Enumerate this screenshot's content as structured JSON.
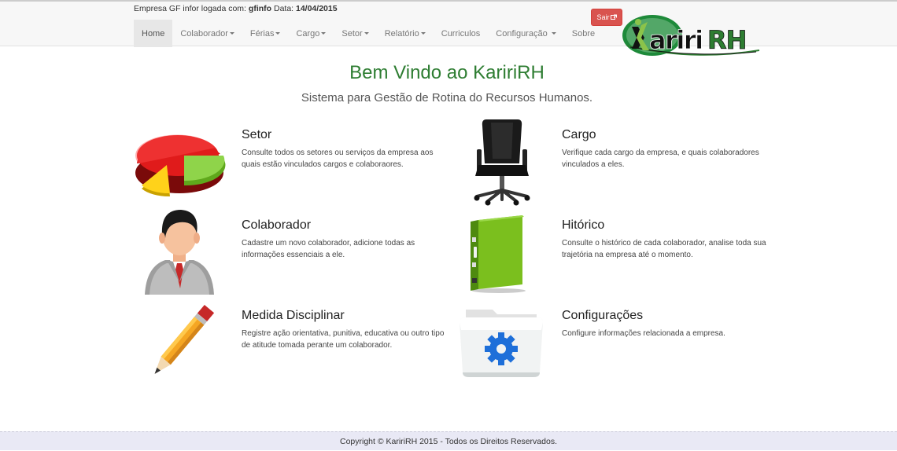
{
  "session": {
    "prefix": "Empresa GF infor logada com: ",
    "user": "gfinfo",
    "date_label": " Data: ",
    "date": "14/04/2015"
  },
  "nav": {
    "items": [
      {
        "label": "Home",
        "dropdown": false
      },
      {
        "label": "Colaborador",
        "dropdown": true
      },
      {
        "label": "Férias",
        "dropdown": true
      },
      {
        "label": "Cargo",
        "dropdown": true
      },
      {
        "label": "Setor",
        "dropdown": true
      },
      {
        "label": "Relatório",
        "dropdown": true
      },
      {
        "label": "Curriculos",
        "dropdown": false
      },
      {
        "label": "Configuração",
        "dropdown": true
      },
      {
        "label": "Sobre",
        "dropdown": false
      }
    ],
    "logout_label": "Sair"
  },
  "logo": {
    "text": "KaririRH"
  },
  "main": {
    "title": "Bem Vindo ao KaririRH",
    "subtitle": "Sistema para Gestão de Rotina do Recursos Humanos."
  },
  "features": {
    "setor": {
      "title": "Setor",
      "desc": "Consulte todos os setores ou serviços da empresa aos quais estão vinculados cargos e colaboraores.",
      "icon": "pie-chart-icon"
    },
    "cargo": {
      "title": "Cargo",
      "desc": "Verifique cada cargo da empresa, e quais colaboradores vinculados a eles.",
      "icon": "office-chair-icon"
    },
    "colaborador": {
      "title": "Colaborador",
      "desc": "Cadastre um novo colaborador, adicione todas as informações essenciais a ele.",
      "icon": "businessman-icon"
    },
    "historico": {
      "title": "Hitórico",
      "desc": "Consulte o histórico de cada colaborador, analise toda sua trajetória na empresa até o momento.",
      "icon": "binder-icon"
    },
    "medida": {
      "title": "Medida Disciplinar",
      "desc": "Registre ação orientativa, punitiva, educativa ou outro tipo de atitude tomada perante um colaborador.",
      "icon": "pencil-icon"
    },
    "config": {
      "title": "Configurações",
      "desc": "Configure informações relacionada a empresa.",
      "icon": "settings-folder-icon"
    }
  },
  "footer": {
    "text": "Copyright © KaririRH 2015 - Todos os Direitos Reservados."
  },
  "colors": {
    "accent_green": "#2e7d32",
    "logout_red": "#d9534f",
    "nav_bg": "#f7f7f7"
  }
}
